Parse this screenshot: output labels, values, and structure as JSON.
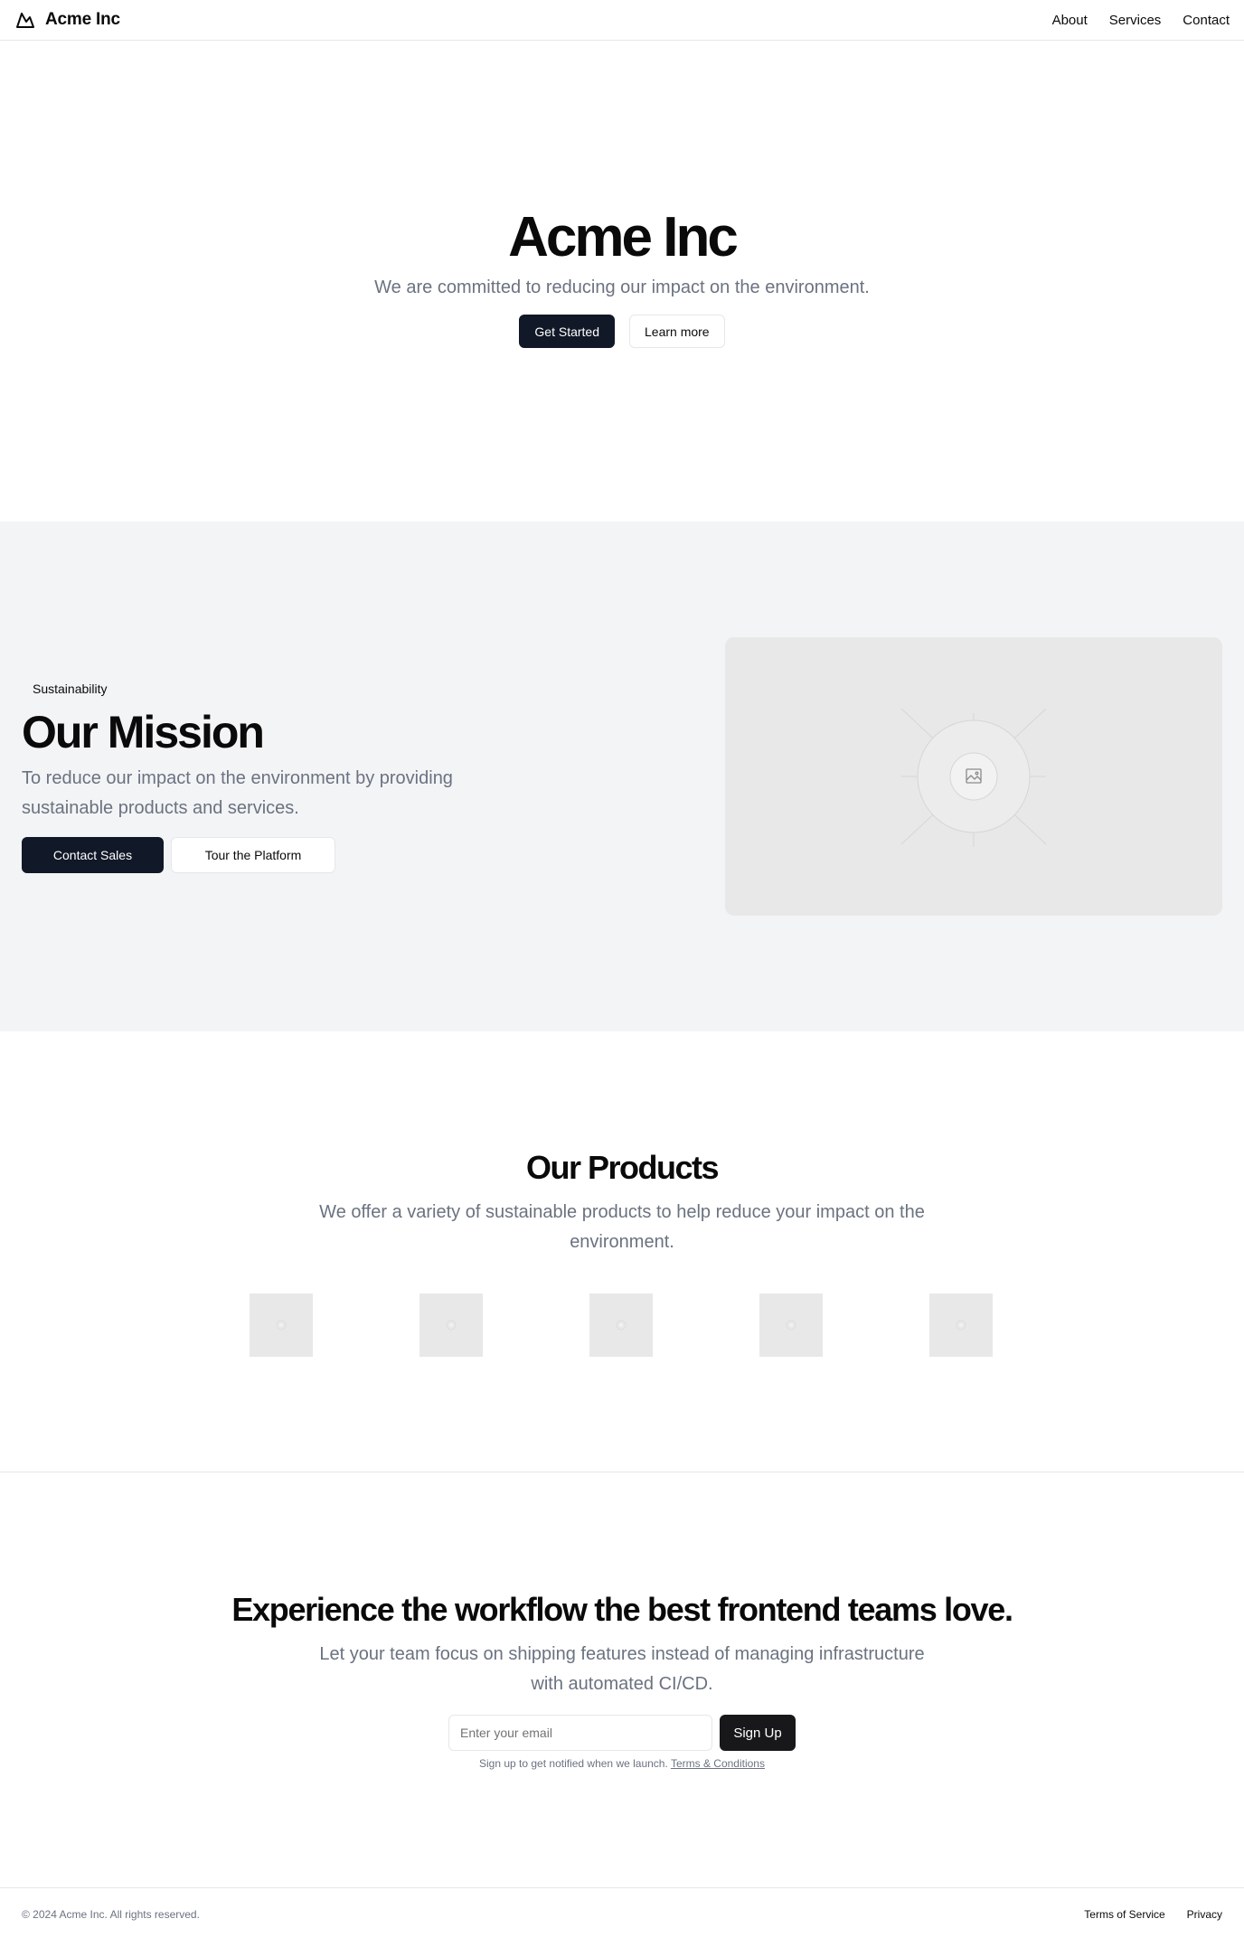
{
  "header": {
    "brand": "Acme Inc",
    "logo_icon": "mountain-icon",
    "nav": [
      {
        "label": "About"
      },
      {
        "label": "Services"
      },
      {
        "label": "Contact"
      }
    ]
  },
  "hero": {
    "title": "Acme Inc",
    "subtitle": "We are committed to reducing our impact on the environment.",
    "primary_button": "Get Started",
    "secondary_button": "Learn more"
  },
  "mission": {
    "badge": "Sustainability",
    "title": "Our Mission",
    "text": "To reduce our impact on the environment by providing sustainable products and services.",
    "primary_button": "Contact Sales",
    "secondary_button": "Tour the Platform",
    "image_icon": "image-placeholder-icon"
  },
  "products": {
    "title": "Our Products",
    "text": "We offer a variety of sustainable products to help reduce your impact on the environment.",
    "items": [
      {
        "icon": "image-placeholder-icon"
      },
      {
        "icon": "image-placeholder-icon"
      },
      {
        "icon": "image-placeholder-icon"
      },
      {
        "icon": "image-placeholder-icon"
      },
      {
        "icon": "image-placeholder-icon"
      }
    ]
  },
  "signup": {
    "title": "Experience the workflow the best frontend teams love.",
    "text": "Let your team focus on shipping features instead of managing infrastructure with automated CI/CD.",
    "email_placeholder": "Enter your email",
    "email_value": "",
    "button": "Sign Up",
    "note": "Sign up to get notified when we launch.",
    "note_link": "Terms & Conditions"
  },
  "footer": {
    "copyright": "© 2024 Acme Inc. All rights reserved.",
    "links": [
      {
        "label": "Terms of Service"
      },
      {
        "label": "Privacy"
      }
    ]
  },
  "colors": {
    "primary": "#111827",
    "muted_text": "#6b7280",
    "section_bg": "#f3f4f6",
    "placeholder_bg": "#e8e8e8",
    "border": "#e5e7eb"
  }
}
